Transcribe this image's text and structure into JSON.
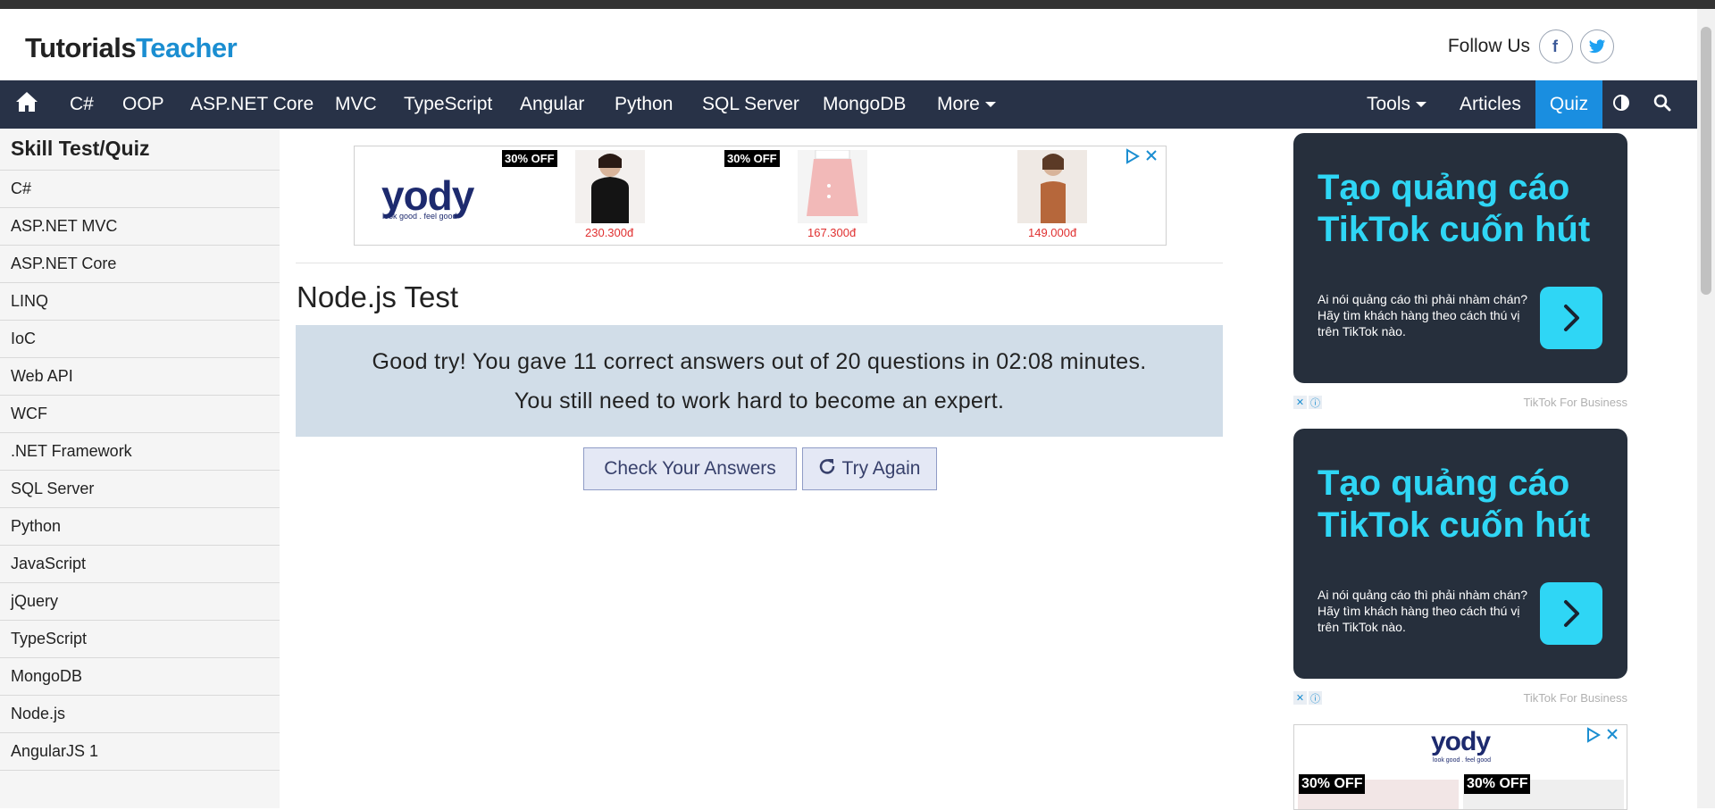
{
  "logo": {
    "part1": "Tutorials",
    "part2": "Teacher"
  },
  "follow": {
    "label": "Follow Us",
    "facebook_icon": "f"
  },
  "nav": {
    "items": [
      "C#",
      "OOP",
      "ASP.NET Core",
      "MVC",
      "TypeScript",
      "Angular",
      "Python",
      "SQL Server",
      "MongoDB",
      "More"
    ],
    "right": {
      "tools": "Tools",
      "articles": "Articles",
      "quiz": "Quiz"
    }
  },
  "sidebar": {
    "title": "Skill Test/Quiz",
    "items": [
      "C#",
      "ASP.NET MVC",
      "ASP.NET Core",
      "LINQ",
      "IoC",
      "Web API",
      "WCF",
      ".NET Framework",
      "SQL Server",
      "Python",
      "JavaScript",
      "jQuery",
      "TypeScript",
      "MongoDB",
      "Node.js",
      "AngularJS 1"
    ]
  },
  "top_ad": {
    "brand": "yody",
    "tagline": "look good . feel good",
    "offers": [
      "30% OFF",
      "30% OFF"
    ],
    "prices": [
      "230.300đ",
      "167.300đ",
      "149.000đ"
    ]
  },
  "main": {
    "title": "Node.js Test",
    "result_line1": "Good try! You gave 11 correct answers out of 20 questions in 02:08 minutes.",
    "result_line2": "You still need to work hard to become an expert.",
    "check_button": "Check Your Answers",
    "retry_button": "Try Again"
  },
  "tiktok_ad": {
    "headline1": "Tạo quảng cáo",
    "headline2": "TikTok cuốn hút",
    "body": "Ai nói quảng cáo thì phải nhàm chán? Hãy tìm khách hàng theo cách thú vị trên TikTok nào.",
    "footer": "TikTok For Business"
  },
  "bottom_ad": {
    "brand": "yody",
    "tagline": "look good . feel good",
    "offers": [
      "30% OFF",
      "30% OFF"
    ]
  },
  "colors": {
    "nav_bg": "#283247",
    "quiz_active": "#1a8ee0",
    "result_bg": "#d1dde8",
    "tiktok_cyan": "#2fd6f5"
  }
}
